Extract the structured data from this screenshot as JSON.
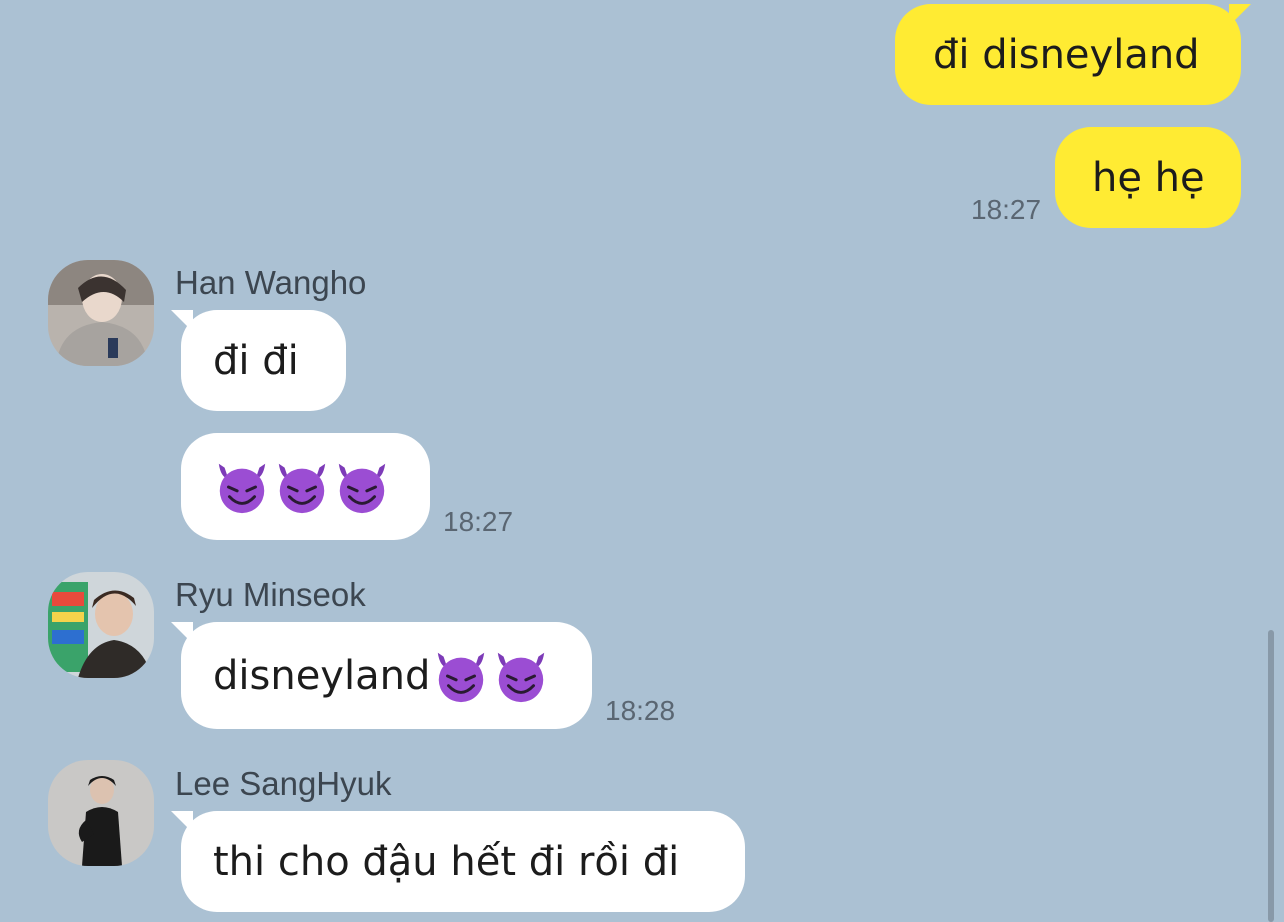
{
  "messages_me": [
    {
      "text": "đi disneyland"
    },
    {
      "text": "hẹ hẹ",
      "time": "18:27"
    }
  ],
  "han": {
    "name": "Han Wangho",
    "msg1": "đi đi",
    "time": "18:27"
  },
  "ryu": {
    "name": "Ryu Minseok",
    "msg1": "disneyland",
    "time": "18:28"
  },
  "lee": {
    "name": "Lee SangHyuk",
    "msg1": "thi cho đậu hết đi rồi đi"
  },
  "colors": {
    "background": "#abc1d3",
    "my_bubble": "#ffeb33",
    "other_bubble": "#ffffff"
  },
  "icons": {
    "emoji": "smiling-devil-emoji"
  }
}
